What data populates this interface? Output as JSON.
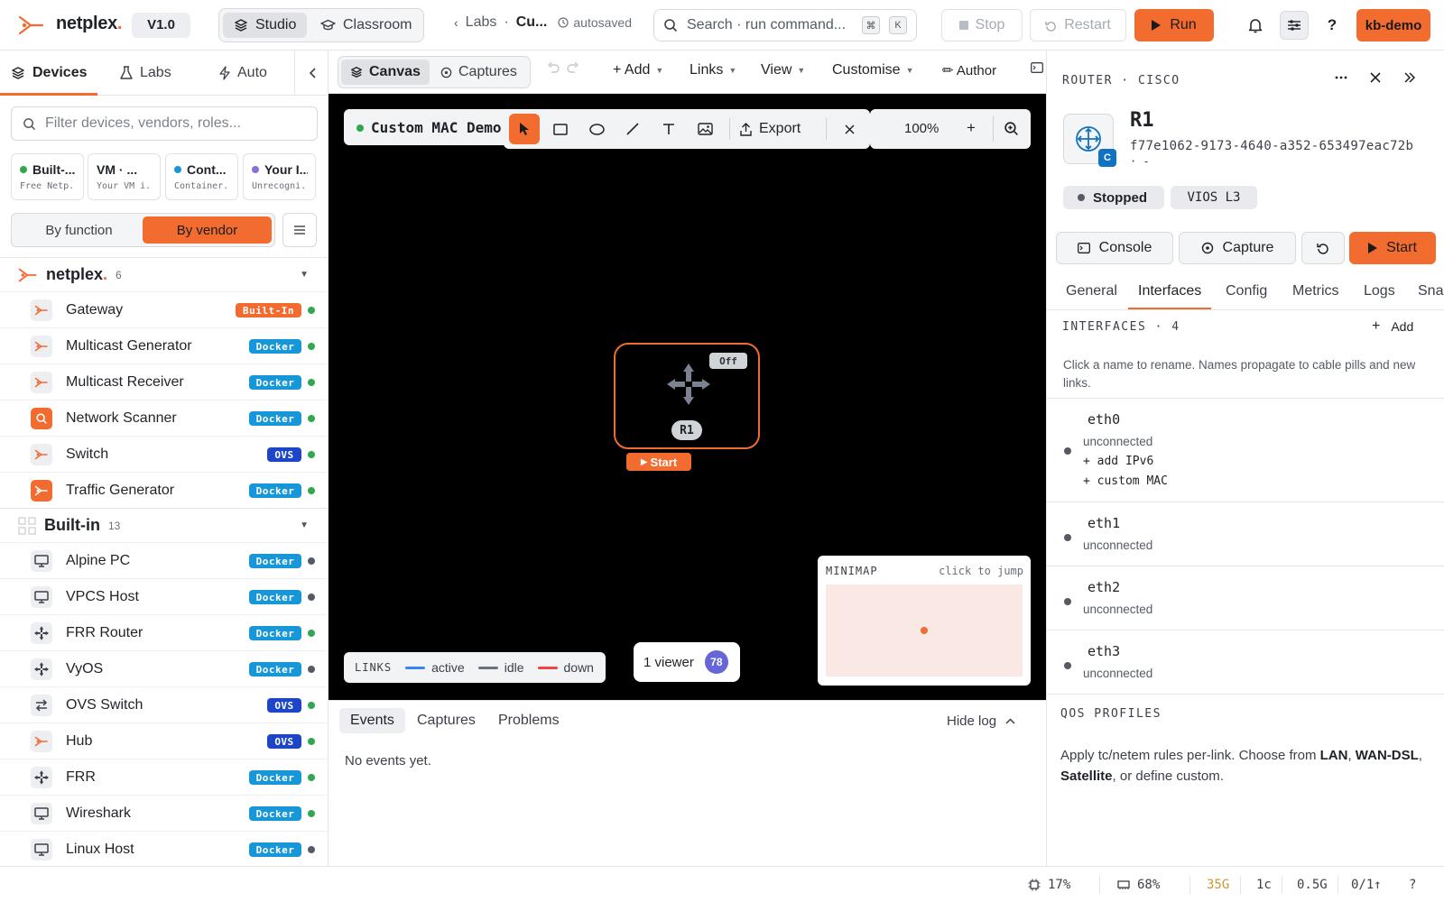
{
  "app": {
    "logo_text": "netplex",
    "logo_dot": ".",
    "version": "V1.0",
    "modes": [
      "Studio",
      "Classroom"
    ],
    "breadcrumb_parent": "Labs",
    "breadcrumb_sep": "·",
    "breadcrumb_current": "Cu...",
    "autosave_status": "autosaved",
    "search_placeholder": "Search · run command...",
    "search_kbd_1": "⌘",
    "search_kbd_2": "K",
    "stop_label": "Stop",
    "restart_label": "Restart",
    "run_label": "Run",
    "help_label": "?",
    "user": "kb-demo"
  },
  "sidebar": {
    "tabs": [
      "Devices",
      "Labs",
      "Auto"
    ],
    "search_placeholder": "Filter devices, vendors, roles...",
    "categories": [
      {
        "name": "Built-...",
        "sub": "Free Netp...",
        "color": "#2fa84f"
      },
      {
        "name": "VM · ...",
        "sub": "Your VM i...",
        "color": "#8a8fe0"
      },
      {
        "name": "Cont...",
        "sub": "Container...",
        "color": "#1796d8"
      },
      {
        "name": "Your I...",
        "sub": "Unrecogni...",
        "color": "#8a6fe0"
      }
    ],
    "toggle": {
      "option1": "By function",
      "option2": "By vendor"
    },
    "groups": [
      {
        "name": "netplex",
        "dot": ".",
        "count": "6"
      },
      {
        "name": "Built-in",
        "count": "13"
      }
    ],
    "netplex_devices": [
      {
        "name": "Gateway",
        "badge": "Built-In",
        "status": "#2fa84f"
      },
      {
        "name": "Multicast Generator",
        "badge": "Docker",
        "status": "#2fa84f"
      },
      {
        "name": "Multicast Receiver",
        "badge": "Docker",
        "status": "#2fa84f"
      },
      {
        "name": "Network Scanner",
        "badge": "Docker",
        "status": "#2fa84f"
      },
      {
        "name": "Switch",
        "badge": "OVS",
        "status": "#2fa84f"
      },
      {
        "name": "Traffic Generator",
        "badge": "Docker",
        "status": "#2fa84f"
      }
    ],
    "builtin_devices": [
      {
        "name": "Alpine PC",
        "badge": "Docker",
        "status": "#555b64"
      },
      {
        "name": "VPCS Host",
        "badge": "Docker",
        "status": "#555b64"
      },
      {
        "name": "FRR Router",
        "badge": "Docker",
        "status": "#2fa84f"
      },
      {
        "name": "VyOS",
        "badge": "Docker",
        "status": "#555b64"
      },
      {
        "name": "OVS Switch",
        "badge": "OVS",
        "status": "#2fa84f"
      },
      {
        "name": "Hub",
        "badge": "OVS",
        "status": "#2fa84f"
      },
      {
        "name": "FRR",
        "badge": "Docker",
        "status": "#2fa84f"
      },
      {
        "name": "Wireshark",
        "badge": "Docker",
        "status": "#2fa84f"
      },
      {
        "name": "Linux Host",
        "badge": "Docker",
        "status": "#555b64"
      }
    ]
  },
  "center": {
    "tabs": [
      "Canvas",
      "Captures"
    ],
    "menus": [
      "+ Add",
      "Links",
      "View",
      "Customise"
    ],
    "author_label": "✏ Author",
    "lab_name": "Custom MAC Demo",
    "export_label": "Export",
    "zoom": "100%",
    "zoom_in": "+",
    "node": {
      "label": "R1",
      "state": "Off",
      "start_label": "Start"
    },
    "links_legend": {
      "title": "LINKS",
      "items": [
        {
          "label": "active",
          "color": "#3b82f6"
        },
        {
          "label": "idle",
          "color": "#6b7280"
        },
        {
          "label": "down",
          "color": "#ef4444"
        }
      ]
    },
    "viewers": {
      "label": "1 viewer",
      "count": "78"
    },
    "minimap": {
      "title": "MINIMAP",
      "hint": "click to jump"
    }
  },
  "log": {
    "tabs": [
      "Events",
      "Captures",
      "Problems"
    ],
    "hide_label": "Hide log",
    "empty": "No events yet."
  },
  "panel": {
    "kicker": "ROUTER · CISCO",
    "title": "R1",
    "uuid": "f77e1062-9173-4640-a352-653497eac72b",
    "uuid_extra": "· -",
    "avatar_badge": "C",
    "status": "Stopped",
    "type": "VIOS L3",
    "actions": [
      "Console",
      "Capture"
    ],
    "start_label": "Start",
    "tabs": [
      "General",
      "Interfaces",
      "Config",
      "Metrics",
      "Logs",
      "Snap"
    ],
    "interfaces_title": "INTERFACES · 4",
    "add_label": "Add",
    "hint": "Click a name to rename. Names propagate to cable pills and new links.",
    "interfaces": [
      {
        "name": "eth0",
        "status": "unconnected",
        "actions": [
          "+ add IPv6",
          "+ custom MAC"
        ]
      },
      {
        "name": "eth1",
        "status": "unconnected"
      },
      {
        "name": "eth2",
        "status": "unconnected"
      },
      {
        "name": "eth3",
        "status": "unconnected"
      }
    ],
    "qos_title": "QOS PROFILES",
    "qos_pre": "Apply tc/netem rules per-link. Choose from ",
    "qos_opt1": "LAN",
    "qos_sep1": ", ",
    "qos_opt2": "WAN-DSL",
    "qos_sep2": ", ",
    "qos_opt3": "Satellite",
    "qos_post": ", or define custom."
  },
  "status": {
    "cpu": "17%",
    "mem": "68%",
    "disk": "35G",
    "cores": "1c",
    "io": "0.5G",
    "net": "0/1↑",
    "help": "?"
  }
}
